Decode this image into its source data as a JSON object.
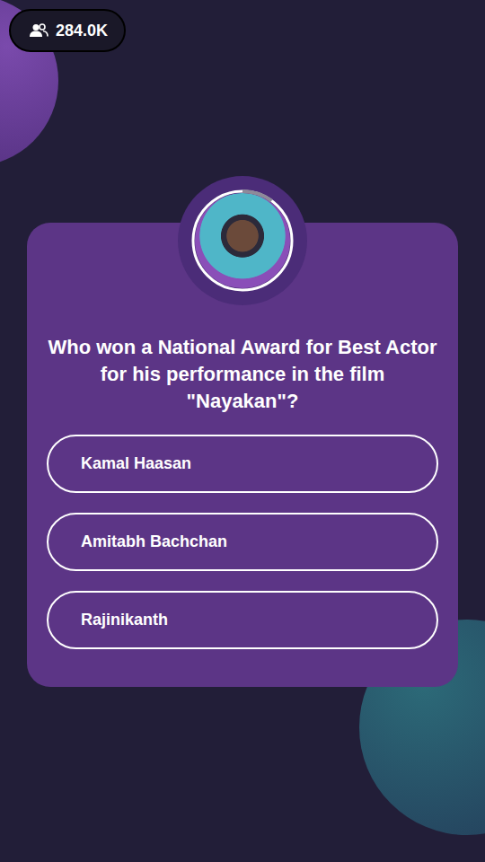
{
  "header": {
    "viewers": "284.0K"
  },
  "host": {
    "video": "host video frame",
    "timer_level": 0.1
  },
  "question": {
    "text": "Who won a National Award for Best Actor for his performance in the film \"Nayakan\"?"
  },
  "options": [
    {
      "label": "Kamal Haasan"
    },
    {
      "label": "Amitabh Bachchan"
    },
    {
      "label": "Rajinikanth"
    }
  ]
}
